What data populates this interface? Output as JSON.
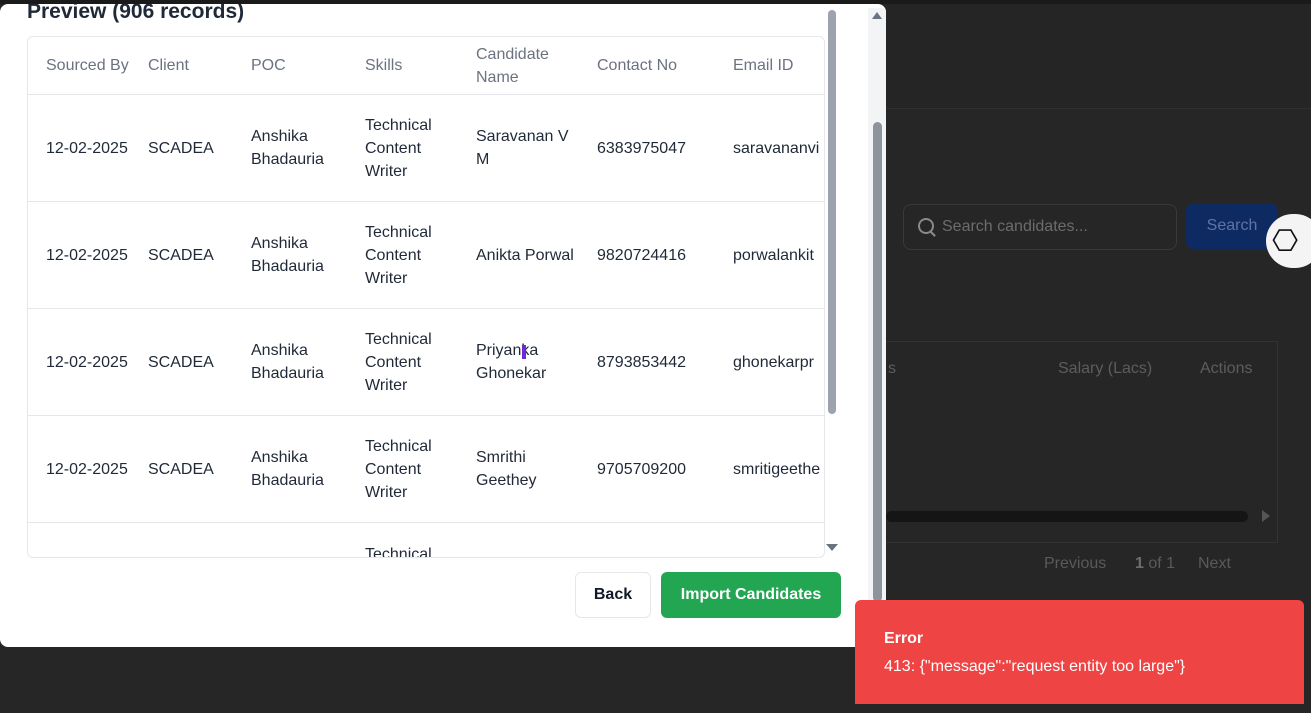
{
  "modal": {
    "title": "Preview (906 records)",
    "columns": [
      "Sourced By",
      "Client",
      "POC",
      "Skills",
      "Candidate Name",
      "Contact No",
      "Email ID"
    ],
    "rows": [
      {
        "sourced_by": "12-02-2025",
        "client": "SCADEA",
        "poc": "Anshika Bhadauria",
        "skills": "Technical Content Writer",
        "candidate": "Saravanan V M",
        "contact": "6383975047",
        "email": "saravananvi"
      },
      {
        "sourced_by": "12-02-2025",
        "client": "SCADEA",
        "poc": "Anshika Bhadauria",
        "skills": "Technical Content Writer",
        "candidate": "Anikta Porwal",
        "contact": "9820724416",
        "email": "porwalankit"
      },
      {
        "sourced_by": "12-02-2025",
        "client": "SCADEA",
        "poc": "Anshika Bhadauria",
        "skills": "Technical Content Writer",
        "candidate": "Priyanka Ghonekar",
        "contact": "8793853442",
        "email": "ghonekarpr"
      },
      {
        "sourced_by": "12-02-2025",
        "client": "SCADEA",
        "poc": "Anshika Bhadauria",
        "skills": "Technical Content Writer",
        "candidate": "Smrithi Geethey",
        "contact": "9705709200",
        "email": "smritigeethe"
      },
      {
        "sourced_by": "",
        "client": "",
        "poc": "",
        "skills": "Technical",
        "candidate": "",
        "contact": "",
        "email": ""
      }
    ],
    "back_label": "Back",
    "import_label": "Import Candidates"
  },
  "background": {
    "search_placeholder": "Search candidates...",
    "search_button": "Search",
    "table_headers": [
      "s",
      "Salary (Lacs)",
      "Actions"
    ],
    "pager": {
      "previous": "Previous",
      "page": "1",
      "of": "of 1",
      "next": "Next"
    }
  },
  "toast": {
    "title": "Error",
    "message": "413: {\"message\":\"request entity too large\"}"
  },
  "colors": {
    "import_button": "#22a652",
    "toast_bg": "#ef4444",
    "search_button_bg": "#0e2a63"
  }
}
